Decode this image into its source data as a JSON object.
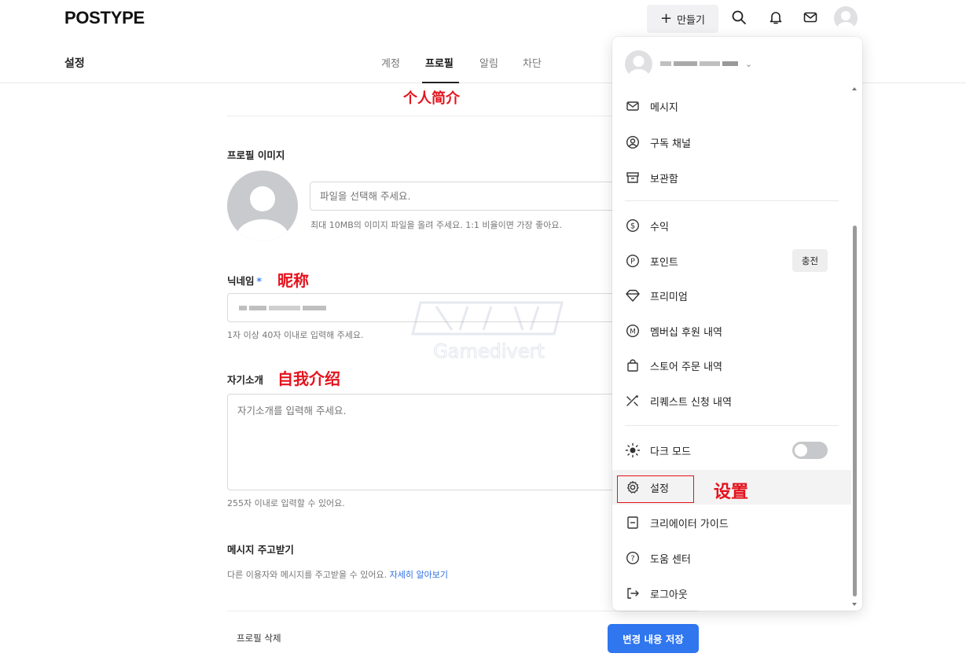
{
  "header": {
    "logo": "POSTYPE",
    "create_label": "만들기"
  },
  "subnav": {
    "title": "설정",
    "tabs": [
      {
        "label": "계정",
        "active": false
      },
      {
        "label": "프로필",
        "active": true
      },
      {
        "label": "알림",
        "active": false
      },
      {
        "label": "차단",
        "active": false
      }
    ]
  },
  "annotations": {
    "profile_intro": "个人简介",
    "nickname": "昵称",
    "self_intro": "自我介绍",
    "settings": "设置"
  },
  "profile_form": {
    "image_label": "프로필 이미지",
    "file_placeholder": "파일을 선택해 주세요.",
    "file_hint": "최대 10MB의 이미지 파일을 올려 주세요. 1:1 비율이면 가장 좋아요.",
    "nickname_label": "닉네임",
    "required_mark": "*",
    "nickname_hint": "1자 이상 40자 이내로 입력해 주세요.",
    "intro_label": "자기소개",
    "intro_placeholder": "자기소개를 입력해 주세요.",
    "intro_hint": "255자 이내로 입력할 수 있어요.",
    "message_label": "메시지 주고받기",
    "message_hint": "다른 이용자와 메시지를 주고받을 수 있어요.",
    "message_link": "자세히 알아보기",
    "delete_label": "프로필 삭제",
    "save_label": "변경 내용 저장"
  },
  "watermark": {
    "text": "Gamedivert"
  },
  "dropdown": {
    "items": [
      {
        "label": "메시지",
        "icon": "mail-icon"
      },
      {
        "label": "구독 채널",
        "icon": "user-circle-icon"
      },
      {
        "label": "보관함",
        "icon": "archive-icon"
      },
      {
        "label": "수익",
        "icon": "dollar-icon"
      },
      {
        "label": "포인트",
        "icon": "point-icon"
      },
      {
        "label": "프리미엄",
        "icon": "diamond-icon"
      },
      {
        "label": "멤버십 후원 내역",
        "icon": "membership-icon"
      },
      {
        "label": "스토어 주문 내역",
        "icon": "shopping-bag-icon"
      },
      {
        "label": "리퀘스트 신청 내역",
        "icon": "request-icon"
      },
      {
        "label": "다크 모드",
        "icon": "sun-icon"
      },
      {
        "label": "설정",
        "icon": "gear-icon"
      },
      {
        "label": "크리에이터 가이드",
        "icon": "book-icon"
      },
      {
        "label": "도움 센터",
        "icon": "help-icon"
      },
      {
        "label": "로그아웃",
        "icon": "logout-icon"
      }
    ],
    "charge_label": "충전",
    "dark_mode_on": false
  },
  "colors": {
    "accent": "#2f76ef",
    "annotation": "#e5121c",
    "link": "#2f6fe4"
  }
}
